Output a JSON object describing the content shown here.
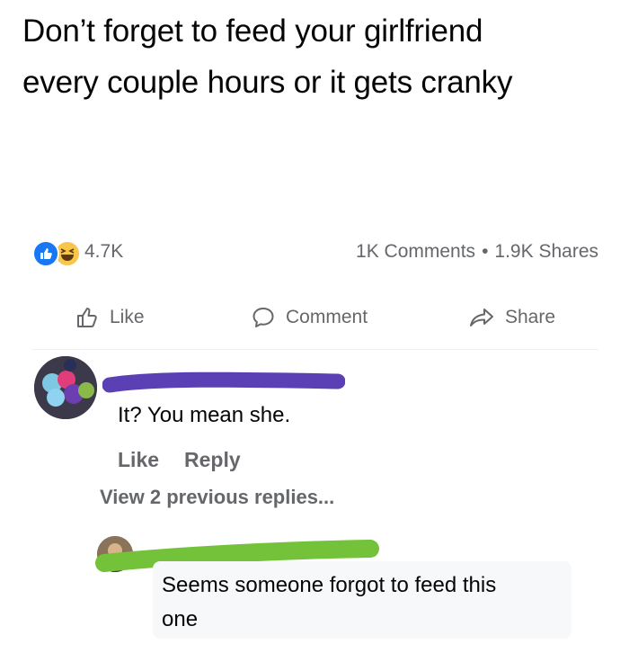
{
  "post": {
    "text_line1": "Don’t forget to feed your girlfriend",
    "text_line2": "every couple hours or it gets cranky"
  },
  "stats": {
    "reactions": [
      "like-icon",
      "haha-icon"
    ],
    "reaction_count": "4.7K",
    "comments": "1K Comments",
    "separator": "•",
    "shares": "1.9K Shares"
  },
  "actions": {
    "like": "Like",
    "comment": "Comment",
    "share": "Share"
  },
  "comments": [
    {
      "avatar": "avatar-icon",
      "name_obscured": true,
      "scribble_color": "#5b3fb4",
      "text": "It? You mean she.",
      "like": "Like",
      "reply": "Reply"
    }
  ],
  "view_previous": "View 2 previous replies...",
  "reply": {
    "avatar": "avatar-icon",
    "name_obscured": true,
    "scribble_color": "#74c23a",
    "text_line1": "Seems someone forgot to feed this",
    "text_line2": "one"
  },
  "colors": {
    "like_blue": "#1877f2",
    "haha_yellow": "#f7c64a",
    "secondary_text": "#65676b"
  }
}
